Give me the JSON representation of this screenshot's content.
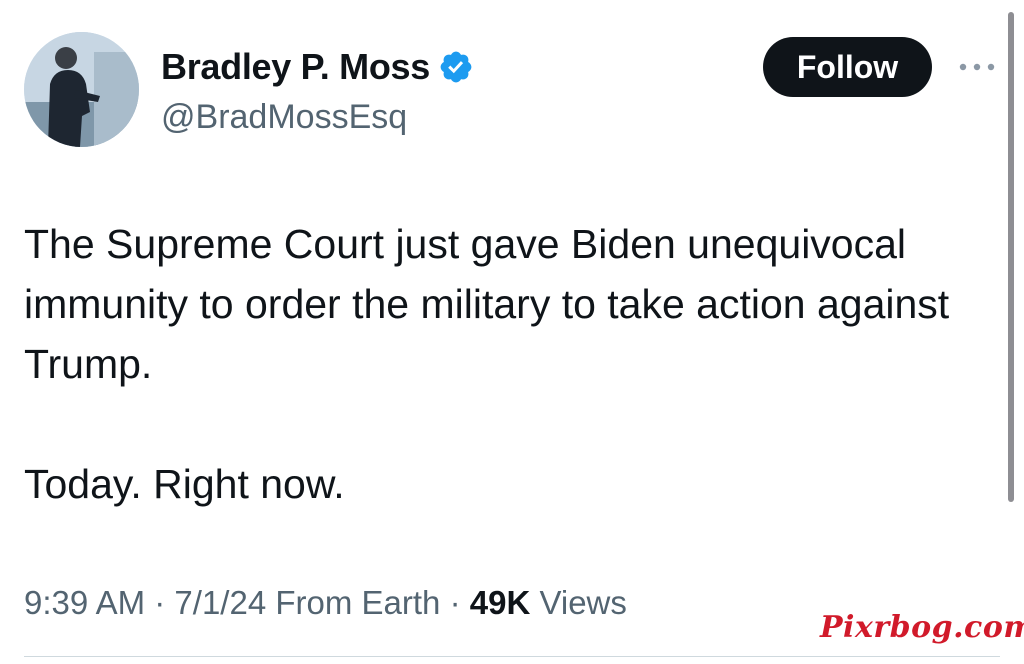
{
  "author": {
    "display_name": "Bradley P. Moss",
    "handle": "@BradMossEsq",
    "verified": true,
    "avatar_icon": "person-avatar",
    "verified_color": "#1d9bf0"
  },
  "actions": {
    "follow_label": "Follow",
    "more_icon": "more-horizontal-icon"
  },
  "tweet": {
    "paragraph_1": "The Supreme Court just gave Biden unequivocal immunity to order the military to take action against Trump.",
    "paragraph_2": "Today. Right now."
  },
  "meta": {
    "time": "9:39 AM",
    "separator": "·",
    "date": "7/1/24",
    "source": "From Earth",
    "views_count": "49K",
    "views_label": "Views"
  },
  "watermark": "Pixrbog.com"
}
